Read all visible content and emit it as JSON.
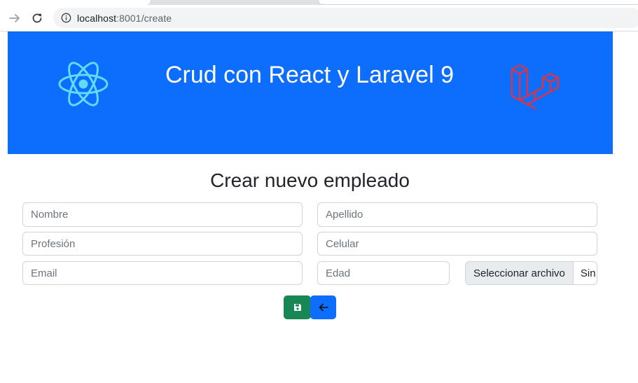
{
  "browser": {
    "url_host": "localhost",
    "url_path": ":8001/create"
  },
  "header": {
    "title": "Crud con React y Laravel 9",
    "left_logo": "react-logo",
    "right_logo": "laravel-logo",
    "background": "#0d6efd"
  },
  "form": {
    "title": "Crear nuevo empleado",
    "nombre_placeholder": "Nombre",
    "apellido_placeholder": "Apellido",
    "profesion_placeholder": "Profesión",
    "celular_placeholder": "Celular",
    "email_placeholder": "Email",
    "edad_placeholder": "Edad",
    "file_button_label": "Seleccionar archivo",
    "file_status": "Sin archivos seleccionados"
  },
  "actions": {
    "save_icon": "floppy-disk-icon",
    "back_icon": "arrow-left-icon",
    "save_color": "#198754",
    "back_color": "#0d6efd"
  }
}
